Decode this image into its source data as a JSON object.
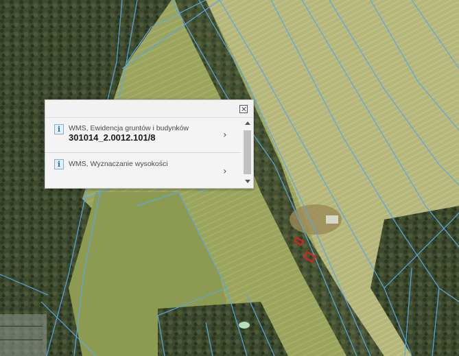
{
  "map": {
    "colors": {
      "forest": "#3b4a2c",
      "field_light": "#a8b06a",
      "field_mid": "#8e9a55",
      "parcel_line": "#58a8e8",
      "highlight": "#e02020"
    }
  },
  "popup": {
    "items": [
      {
        "title": "WMS, Ewidencja gruntów i budynków",
        "value": "301014_2.0012.101/8",
        "icon": "info-icon"
      },
      {
        "title": "WMS, Wyznaczanie wysokości",
        "value": "",
        "icon": "info-icon"
      }
    ],
    "close_icon": "close-icon",
    "chevron_icon": "chevron-right-icon"
  }
}
